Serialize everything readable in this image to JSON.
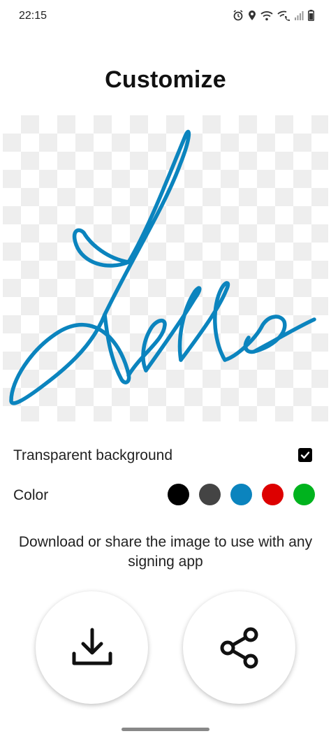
{
  "status_bar": {
    "time": "22:15",
    "icons": [
      "alarm-icon",
      "location-icon",
      "wifi-icon",
      "wifi-calling-icon",
      "signal-icon",
      "battery-icon"
    ]
  },
  "page": {
    "title": "Customize"
  },
  "signature": {
    "stroke_color": "#0b84be",
    "icon": "signature-drawing"
  },
  "options": {
    "transparent_label": "Transparent background",
    "transparent_checked": true,
    "color_label": "Color",
    "colors": [
      "#000000",
      "#444444",
      "#0b84be",
      "#dd0000",
      "#00b31e"
    ],
    "selected_color": "#0b84be"
  },
  "info_text": "Download or share the image to use with any signing app",
  "actions": {
    "download_icon": "download-icon",
    "share_icon": "share-icon"
  }
}
